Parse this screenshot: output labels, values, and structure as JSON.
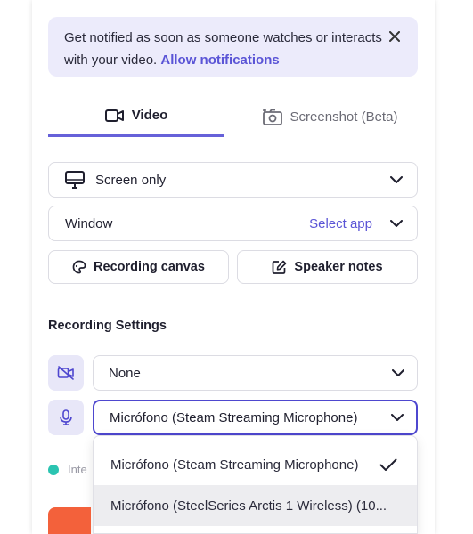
{
  "notice": {
    "text": "Get notified as soon as someone watches or interacts with your video.",
    "link": "Allow notifications"
  },
  "tabs": {
    "video": "Video",
    "screenshot": "Screenshot (Beta)"
  },
  "capture": {
    "mode": "Screen only",
    "window_label": "Window",
    "select_app": "Select app"
  },
  "buttons": {
    "canvas": "Recording canvas",
    "notes": "Speaker notes"
  },
  "settings": {
    "title": "Recording Settings",
    "camera": "None",
    "microphone": "Micrófono (Steam Streaming Microphone)"
  },
  "mic_options": [
    "Micrófono (Steam Streaming Microphone)",
    "Micrófono (SteelSeries Arctis 1 Wireless) (10..."
  ],
  "partial_label": "Inte",
  "colors": {
    "accent": "#5a54d6",
    "active_border": "#4e47cf",
    "record": "#f3613b",
    "status_dot": "#2bc4b1"
  }
}
